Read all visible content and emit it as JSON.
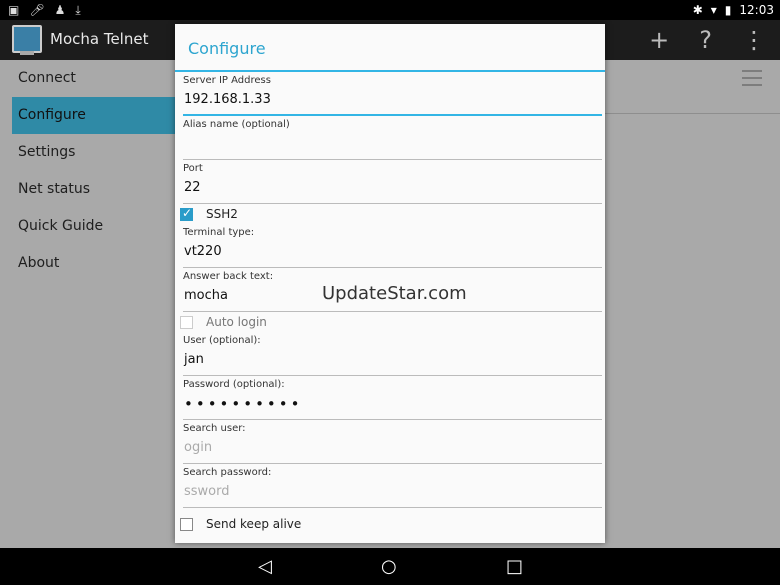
{
  "status": {
    "time": "12:03"
  },
  "app": {
    "title": "Mocha Telnet",
    "actions": [
      "+",
      "?",
      "⋮"
    ]
  },
  "sidebar": {
    "items": [
      {
        "label": "Connect"
      },
      {
        "label": "Configure"
      },
      {
        "label": "Settings"
      },
      {
        "label": "Net status"
      },
      {
        "label": "Quick Guide"
      },
      {
        "label": "About"
      }
    ]
  },
  "dialog": {
    "title": "Configure",
    "server_ip": {
      "label": "Server IP Address",
      "value": "192.168.1.33"
    },
    "alias": {
      "label": "Alias name (optional)",
      "value": ""
    },
    "port": {
      "label": "Port",
      "value": "22"
    },
    "ssh2": {
      "label": "SSH2",
      "checked": true
    },
    "terminal_type": {
      "label": "Terminal type:",
      "value": "vt220"
    },
    "answer_back": {
      "label": "Answer back text:",
      "value": "mocha"
    },
    "auto_login": {
      "label": "Auto login",
      "checked": false
    },
    "user": {
      "label": "User (optional):",
      "value": "jan"
    },
    "password": {
      "label": "Password (optional):",
      "value": "••••••••••"
    },
    "search_user": {
      "label": "Search user:",
      "placeholder": "ogin"
    },
    "search_password": {
      "label": "Search password:",
      "placeholder": "ssword"
    },
    "keep_alive": {
      "label": "Send keep alive",
      "checked": false
    }
  },
  "watermark": "UpdateStar.com",
  "colors": {
    "accent": "#33b5e5",
    "selected": "#2f8aa6"
  }
}
